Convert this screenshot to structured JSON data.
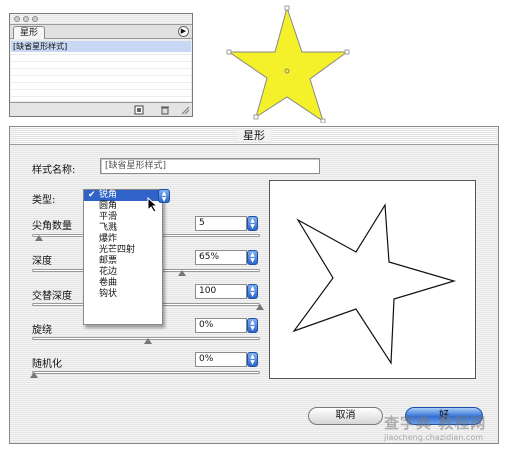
{
  "palette": {
    "tab_label": "星形",
    "styles": [
      "[缺省星形样式]"
    ]
  },
  "dialog": {
    "title": "星形",
    "style_name_label": "样式名称:",
    "style_name_value": "[缺省星形样式]",
    "type_label": "类型:",
    "type_selected": "锐角",
    "type_options": [
      "锐角",
      "圆角",
      "平滑",
      "飞溅",
      "爆炸",
      "光芒四射",
      "邮票",
      "花边",
      "卷曲",
      "钩状"
    ],
    "points_label": "尖角数量",
    "points_value": "5",
    "depth_label": "深度",
    "depth_value": "65%",
    "alt_depth_label": "交替深度",
    "alt_depth_value": "100",
    "twist_label": "旋绕",
    "twist_value": "0%",
    "randomize_label": "随机化",
    "randomize_value": "0%",
    "cancel_label": "取消",
    "ok_label": "好"
  },
  "colors": {
    "star_fill": "#f4f02a",
    "accent_blue": "#2f63c8"
  },
  "watermark": {
    "main": "查字典 教程网",
    "url": "jiaocheng.chazidian.com"
  }
}
